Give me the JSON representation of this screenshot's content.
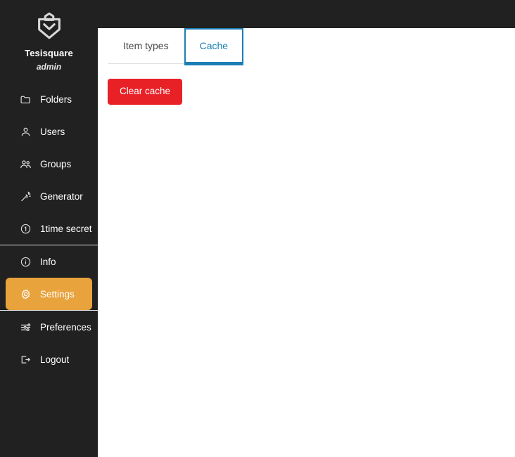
{
  "brand": {
    "logo_icon": "shield-chevron-logo",
    "name": "Tesisquare",
    "role": "admin"
  },
  "sidebar": {
    "groups": [
      {
        "items": [
          {
            "id": "folders",
            "label": "Folders",
            "icon": "folder-icon",
            "active": false
          },
          {
            "id": "users",
            "label": "Users",
            "icon": "user-icon",
            "active": false
          },
          {
            "id": "groups",
            "label": "Groups",
            "icon": "users-group-icon",
            "active": false
          },
          {
            "id": "generator",
            "label": "Generator",
            "icon": "magic-wand-icon",
            "active": false
          },
          {
            "id": "onetime-secret",
            "label": "1time secret",
            "icon": "circled-one-icon",
            "active": false
          }
        ]
      },
      {
        "items": [
          {
            "id": "info",
            "label": "Info",
            "icon": "info-circle-icon",
            "active": false
          },
          {
            "id": "settings",
            "label": "Settings",
            "icon": "gear-icon",
            "active": true
          }
        ]
      },
      {
        "items": [
          {
            "id": "preferences",
            "label": "Preferences",
            "icon": "sliders-icon",
            "active": false
          },
          {
            "id": "logout",
            "label": "Logout",
            "icon": "logout-arrow-icon",
            "active": false
          }
        ]
      }
    ]
  },
  "main": {
    "tabs": [
      {
        "id": "item-types",
        "label": "Item types",
        "active": false
      },
      {
        "id": "cache",
        "label": "Cache",
        "active": true
      }
    ],
    "panel": {
      "clear_cache_label": "Clear cache"
    }
  },
  "colors": {
    "sidebar_background": "#212121",
    "topbar_background": "#212121",
    "active_item": "#e8a33d",
    "tab_active": "#1b7fb5",
    "danger_button": "#e82127",
    "content_background": "#ffffff"
  }
}
